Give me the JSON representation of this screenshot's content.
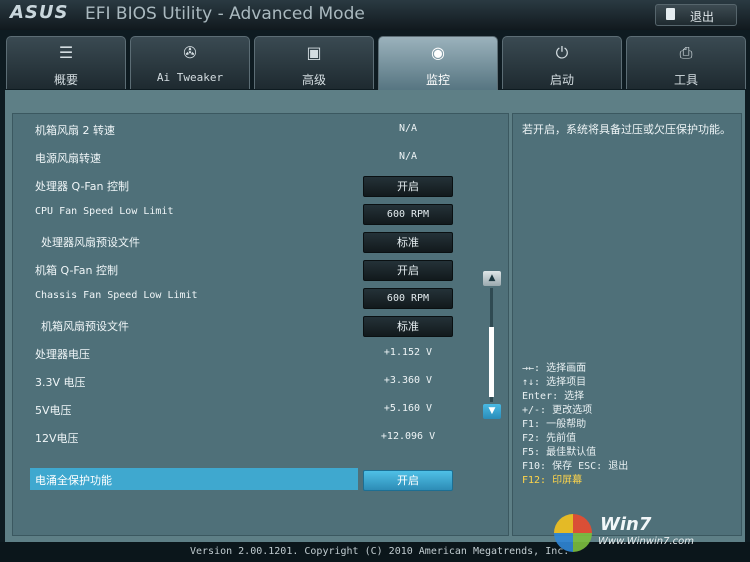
{
  "header": {
    "brand": "ASUS",
    "title": "EFI BIOS Utility - Advanced Mode",
    "exit_label": "退出"
  },
  "tabs": [
    {
      "label": "概要",
      "icon": "list-icon"
    },
    {
      "label": "Ai Tweaker",
      "icon": "fan-tweak-icon"
    },
    {
      "label": "高级",
      "icon": "monitor-gear-icon"
    },
    {
      "label": "监控",
      "icon": "monitor-gauge-icon",
      "active": true
    },
    {
      "label": "启动",
      "icon": "power-icon"
    },
    {
      "label": "工具",
      "icon": "printer-tool-icon"
    }
  ],
  "settings": [
    {
      "label": "机箱风扇 2 转速",
      "value": "N/A"
    },
    {
      "label": "电源风扇转速",
      "value": "N/A"
    },
    {
      "label": "处理器 Q-Fan 控制",
      "button": "开启"
    },
    {
      "label": "CPU Fan Speed Low Limit",
      "button": "600 RPM"
    },
    {
      "label": "处理器风扇预设文件",
      "button": "标准"
    },
    {
      "label": "机箱 Q-Fan 控制",
      "button": "开启"
    },
    {
      "label": "Chassis Fan Speed Low Limit",
      "button": "600 RPM"
    },
    {
      "label": "机箱风扇预设文件",
      "button": "标准"
    },
    {
      "label": "处理器电压",
      "value": "+1.152 V"
    },
    {
      "label": "3.3V 电压",
      "value": "+3.360 V"
    },
    {
      "label": "5V电压",
      "value": "+5.160 V"
    },
    {
      "label": "12V电压",
      "value": "+12.096 V"
    },
    {
      "label": "电涌全保护功能",
      "button": "开启",
      "selected": true
    }
  ],
  "help": {
    "description": "若开启，系统将具备过压或欠压保护功能。",
    "keys": [
      "→←: 选择画面",
      "↑↓: 选择项目",
      "Enter: 选择",
      "+/-: 更改选项",
      "F1: 一般帮助",
      "F2: 先前值",
      "F5: 最佳默认值",
      "F10: 保存  ESC: 退出",
      "F12: 印屏幕"
    ]
  },
  "footer": "Version 2.00.1201. Copyright (C) 2010 American Megatrends, Inc.",
  "watermark": {
    "title": "Win7",
    "url": "Www.Winwin7.com"
  },
  "colors": {
    "accent": "#3fa8cf",
    "panel": "#5e7f86",
    "active_tab": "#9bb2bc",
    "key_highlight": "#ffd54a"
  }
}
